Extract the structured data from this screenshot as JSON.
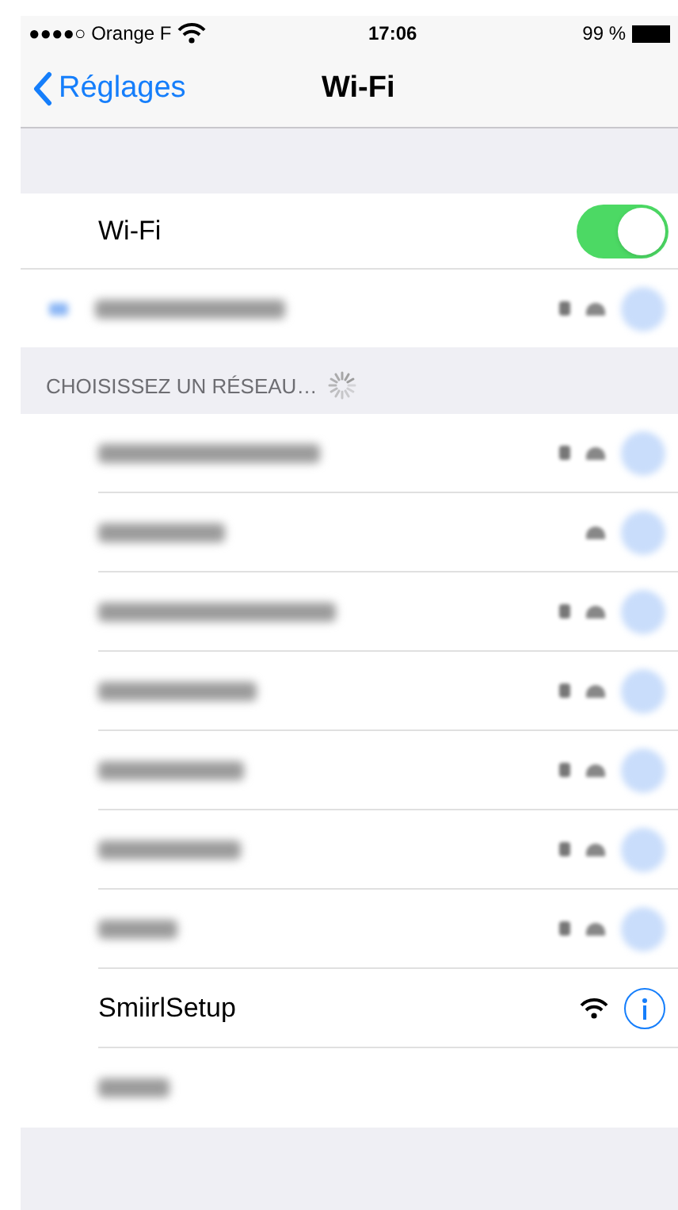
{
  "status_bar": {
    "carrier": "●●●●○ Orange F",
    "time": "17:06",
    "battery": "99 %"
  },
  "nav": {
    "back": "Réglages",
    "title": "Wi-Fi"
  },
  "wifi": {
    "label": "Wi-Fi",
    "on": true
  },
  "current": {
    "kind": "redacted",
    "locked": true,
    "connected": true
  },
  "section_header": "CHOISISSEZ UN RÉSEAU…",
  "networks": [
    {
      "kind": "redacted",
      "locked": true
    },
    {
      "kind": "redacted",
      "locked": false
    },
    {
      "kind": "redacted",
      "locked": true
    },
    {
      "kind": "redacted",
      "locked": true
    },
    {
      "kind": "redacted",
      "locked": true
    },
    {
      "kind": "redacted",
      "locked": true
    },
    {
      "kind": "redacted",
      "locked": true
    },
    {
      "kind": "visible",
      "name": "SmiirlSetup",
      "locked": false
    },
    {
      "kind": "other"
    }
  ]
}
